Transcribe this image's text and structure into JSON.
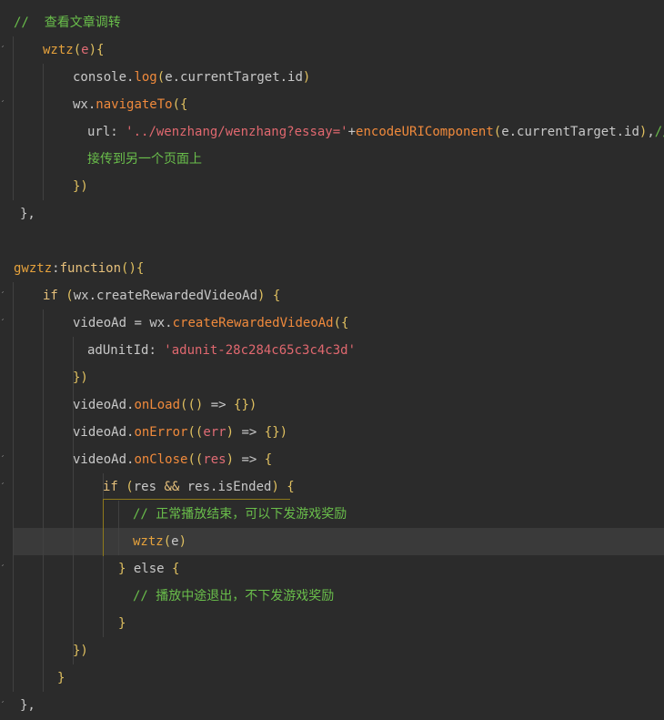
{
  "colors": {
    "background": "#2b2b2b",
    "comment": "#6abf4b",
    "text": "#c8c8c8",
    "function": "#e6a23c",
    "paren": "#e0c060",
    "brace": "#e0c060",
    "string": "#e0686f",
    "keyword": "#e6c07b",
    "param": "#e06c75",
    "method": "#f08a3c",
    "punct": "#c8c8c8",
    "highlight": "#3a3a3a",
    "bracket_match_border": "#8f7a1b"
  },
  "lines": [
    {
      "indent": 15,
      "tokens": [
        {
          "t": "//  查看文章调转",
          "c": "comment"
        }
      ]
    },
    {
      "indent": 47,
      "tokens": [
        {
          "t": "wztz",
          "c": "function"
        },
        {
          "t": "(",
          "c": "paren"
        },
        {
          "t": "e",
          "c": "param"
        },
        {
          "t": ")",
          "c": "paren"
        },
        {
          "t": "{",
          "c": "brace"
        }
      ]
    },
    {
      "indent": 80,
      "tokens": [
        {
          "t": "console",
          "c": "text"
        },
        {
          "t": ".",
          "c": "punct"
        },
        {
          "t": "log",
          "c": "method"
        },
        {
          "t": "(",
          "c": "paren"
        },
        {
          "t": "e",
          "c": "text"
        },
        {
          "t": ".currentTarget.id",
          "c": "text"
        },
        {
          "t": ")",
          "c": "paren"
        }
      ]
    },
    {
      "indent": 80,
      "tokens": [
        {
          "t": "wx",
          "c": "text"
        },
        {
          "t": ".",
          "c": "punct"
        },
        {
          "t": "navigateTo",
          "c": "method"
        },
        {
          "t": "({",
          "c": "paren"
        }
      ]
    },
    {
      "indent": 96,
      "tokens": [
        {
          "t": "url",
          "c": "text"
        },
        {
          "t": ": ",
          "c": "punct"
        },
        {
          "t": "'../wenzhang/wenzhang?essay='",
          "c": "string"
        },
        {
          "t": "+",
          "c": "text"
        },
        {
          "t": "encodeURIComponent",
          "c": "method"
        },
        {
          "t": "(",
          "c": "paren"
        },
        {
          "t": "e.currentTarget.id",
          "c": "text"
        },
        {
          "t": ")",
          "c": "paren"
        },
        {
          "t": ",",
          "c": "punct"
        },
        {
          "t": "//",
          "c": "comment"
        }
      ]
    },
    {
      "indent": 96,
      "tokens": [
        {
          "t": "接传到另一个页面上",
          "c": "comment"
        }
      ]
    },
    {
      "indent": 80,
      "tokens": [
        {
          "t": "})",
          "c": "paren"
        }
      ]
    },
    {
      "indent": 22,
      "tokens": [
        {
          "t": "},",
          "c": "text"
        }
      ]
    },
    {
      "indent": 15,
      "tokens": []
    },
    {
      "indent": 15,
      "tokens": [
        {
          "t": "gwztz",
          "c": "function"
        },
        {
          "t": ":",
          "c": "punct"
        },
        {
          "t": "function",
          "c": "keyword"
        },
        {
          "t": "()",
          "c": "paren"
        },
        {
          "t": "{",
          "c": "brace"
        }
      ]
    },
    {
      "indent": 47,
      "tokens": [
        {
          "t": "if",
          "c": "keyword"
        },
        {
          "t": " (",
          "c": "paren"
        },
        {
          "t": "wx.createRewardedVideoAd",
          "c": "text"
        },
        {
          "t": ") {",
          "c": "paren"
        }
      ]
    },
    {
      "indent": 80,
      "tokens": [
        {
          "t": "videoAd",
          "c": "text"
        },
        {
          "t": " = ",
          "c": "punct"
        },
        {
          "t": "wx",
          "c": "text"
        },
        {
          "t": ".",
          "c": "punct"
        },
        {
          "t": "createRewardedVideoAd",
          "c": "method"
        },
        {
          "t": "({",
          "c": "paren"
        }
      ]
    },
    {
      "indent": 96,
      "tokens": [
        {
          "t": "adUnitId",
          "c": "text"
        },
        {
          "t": ": ",
          "c": "punct"
        },
        {
          "t": "'adunit-28c284c65c3c4c3d'",
          "c": "string"
        }
      ]
    },
    {
      "indent": 80,
      "tokens": [
        {
          "t": "})",
          "c": "paren"
        }
      ]
    },
    {
      "indent": 80,
      "tokens": [
        {
          "t": "videoAd",
          "c": "text"
        },
        {
          "t": ".",
          "c": "punct"
        },
        {
          "t": "onLoad",
          "c": "method"
        },
        {
          "t": "(()",
          "c": "paren"
        },
        {
          "t": " => ",
          "c": "text"
        },
        {
          "t": "{})",
          "c": "paren"
        }
      ]
    },
    {
      "indent": 80,
      "tokens": [
        {
          "t": "videoAd",
          "c": "text"
        },
        {
          "t": ".",
          "c": "punct"
        },
        {
          "t": "onError",
          "c": "method"
        },
        {
          "t": "((",
          "c": "paren"
        },
        {
          "t": "err",
          "c": "param"
        },
        {
          "t": ")",
          "c": "paren"
        },
        {
          "t": " => ",
          "c": "text"
        },
        {
          "t": "{})",
          "c": "paren"
        }
      ]
    },
    {
      "indent": 80,
      "tokens": [
        {
          "t": "videoAd",
          "c": "text"
        },
        {
          "t": ".",
          "c": "punct"
        },
        {
          "t": "onClose",
          "c": "method"
        },
        {
          "t": "((",
          "c": "paren"
        },
        {
          "t": "res",
          "c": "param"
        },
        {
          "t": ")",
          "c": "paren"
        },
        {
          "t": " => ",
          "c": "text"
        },
        {
          "t": "{",
          "c": "brace"
        }
      ]
    },
    {
      "indent": 113,
      "tokens": [
        {
          "t": "if",
          "c": "keyword"
        },
        {
          "t": " (",
          "c": "paren"
        },
        {
          "t": "res ",
          "c": "text"
        },
        {
          "t": "&&",
          "c": "keyword"
        },
        {
          "t": " res.isEnded",
          "c": "text"
        },
        {
          "t": ") {",
          "c": "paren"
        }
      ]
    },
    {
      "indent": 146,
      "tokens": [
        {
          "t": "// 正常播放结束，可以下发游戏奖励",
          "c": "comment"
        }
      ]
    },
    {
      "indent": 146,
      "tokens": [
        {
          "t": "wztz",
          "c": "function"
        },
        {
          "t": "(",
          "c": "paren"
        },
        {
          "t": "e",
          "c": "text"
        },
        {
          "t": ")",
          "c": "paren"
        }
      ]
    },
    {
      "indent": 130,
      "tokens": [
        {
          "t": "}",
          "c": "brace"
        },
        {
          "t": " else ",
          "c": "text"
        },
        {
          "t": "{",
          "c": "brace"
        }
      ]
    },
    {
      "indent": 146,
      "tokens": [
        {
          "t": "// 播放中途退出，不下发游戏奖励",
          "c": "comment"
        }
      ]
    },
    {
      "indent": 130,
      "tokens": [
        {
          "t": "}",
          "c": "brace"
        }
      ]
    },
    {
      "indent": 80,
      "tokens": [
        {
          "t": "})",
          "c": "paren"
        }
      ]
    },
    {
      "indent": 63,
      "tokens": [
        {
          "t": "}",
          "c": "brace"
        }
      ]
    },
    {
      "indent": 22,
      "tokens": [
        {
          "t": "},",
          "c": "text"
        }
      ]
    }
  ],
  "current_line": 19
}
